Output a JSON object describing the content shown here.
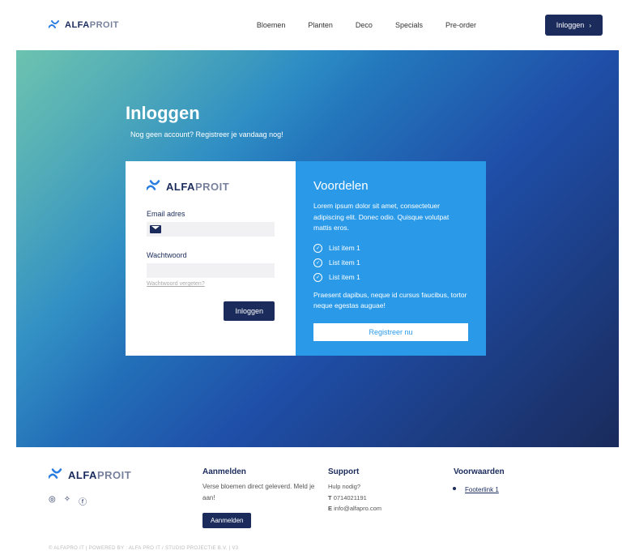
{
  "brand": {
    "alfa": "ALFA",
    "pro": "PROIT"
  },
  "nav": {
    "items": [
      "Bloemen",
      "Planten",
      "Deco",
      "Specials",
      "Pre-order"
    ]
  },
  "header_button": "Inloggen",
  "hero": {
    "title": "Inloggen",
    "subtitle": "Nog geen account? Registreer je vandaag nog!"
  },
  "login": {
    "email_label": "Email adres",
    "password_label": "Wachtwoord",
    "forgot": "Wachtwoord vergeten?",
    "button": "Inloggen"
  },
  "benefits": {
    "title": "Voordelen",
    "text1": "Lorem ipsum dolor sit amet, consectetuer adipiscing elit. Donec odio. Quisque volutpat mattis eros.",
    "items": [
      "List item 1",
      "List item 1",
      "List item 1"
    ],
    "text2": "Praesent dapibus, neque id cursus faucibus, tortor neque egestas auguae!",
    "button": "Registreer nu"
  },
  "footer": {
    "col2": {
      "heading": "Aanmelden",
      "text": "Verse bloemen direct geleverd. Meld je aan!",
      "button": "Aanmelden"
    },
    "col3": {
      "heading": "Support",
      "line1": "Hulp nodig?",
      "phone_label": "T",
      "phone": "0714021191",
      "email_label": "E",
      "email": "info@alfapro.com"
    },
    "col4": {
      "heading": "Voorwaarden",
      "link": "Footerlink 1"
    },
    "copyright": "© ALFAPRO IT | POWERED BY : ALFA PRO IT / STUDIO PROJECTIE B.V. | V3"
  }
}
